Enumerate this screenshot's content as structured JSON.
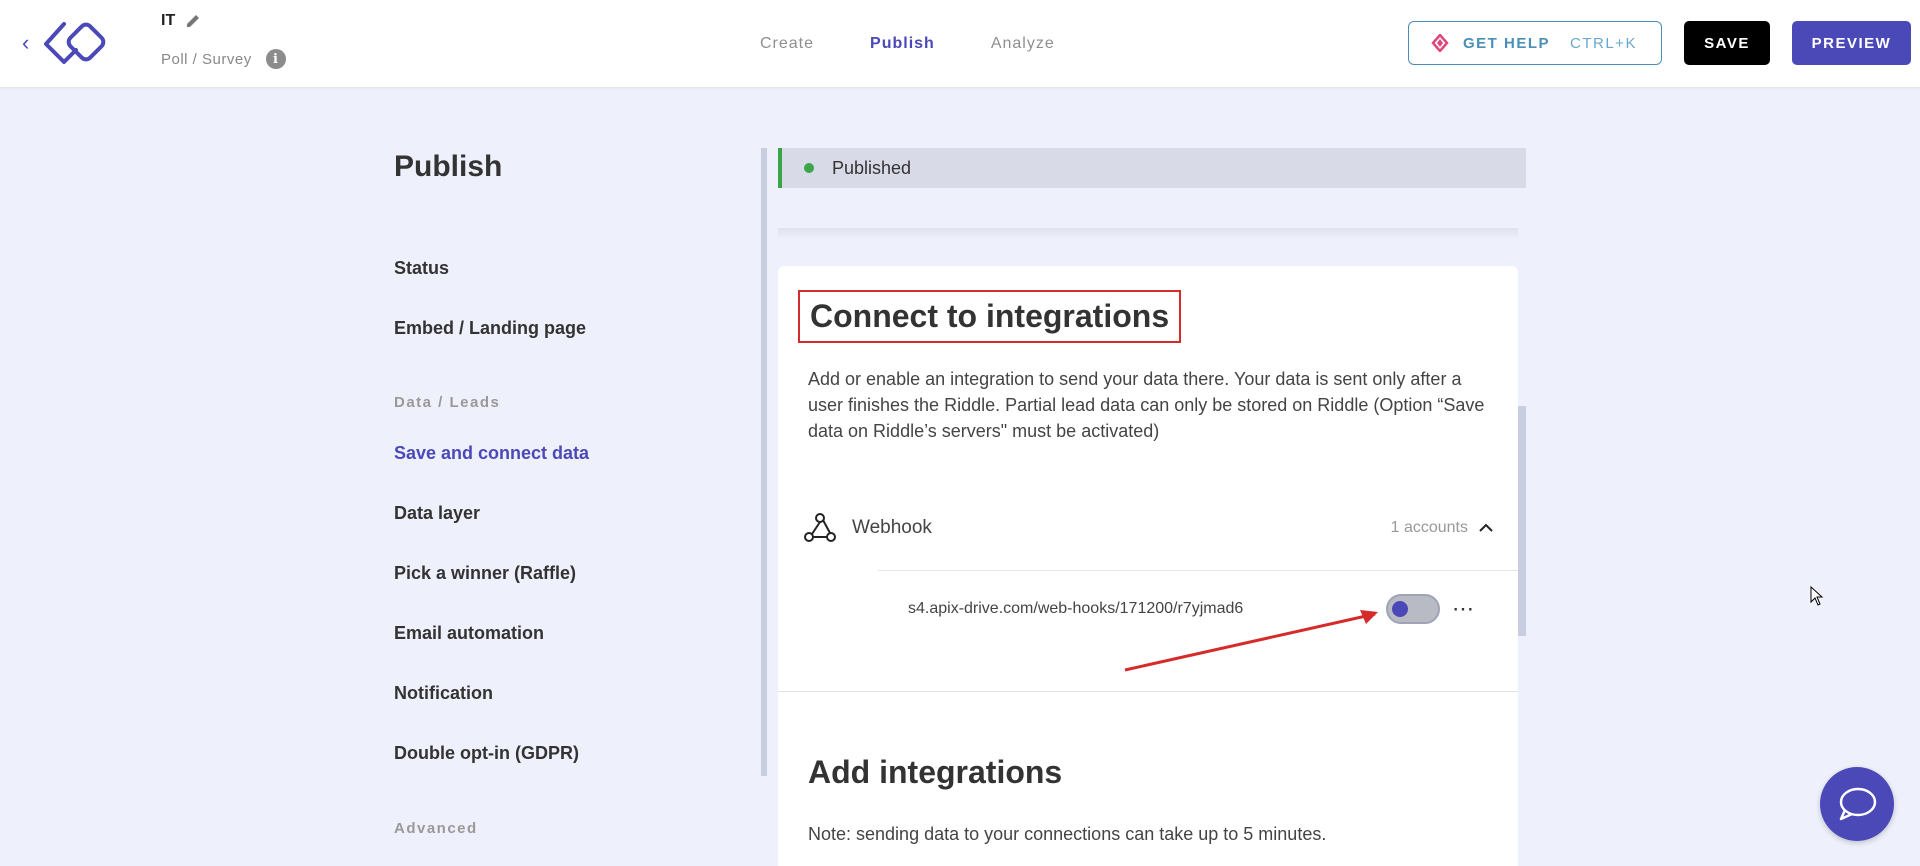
{
  "header": {
    "project_title": "IT",
    "project_type": "Poll / Survey",
    "tabs": [
      {
        "label": "Create",
        "active": false
      },
      {
        "label": "Publish",
        "active": true
      },
      {
        "label": "Analyze",
        "active": false
      }
    ],
    "help_label": "GET HELP",
    "help_shortcut": "CTRL+K",
    "save_label": "SAVE",
    "preview_label": "PREVIEW"
  },
  "sidebar": {
    "heading": "Publish",
    "items": [
      {
        "label": "Status"
      },
      {
        "label": "Embed / Landing page"
      },
      {
        "section": "Data / Leads"
      },
      {
        "label": "Save and connect data",
        "active": true
      },
      {
        "label": "Data layer"
      },
      {
        "label": "Pick a winner (Raffle)"
      },
      {
        "label": "Email automation"
      },
      {
        "label": "Notification"
      },
      {
        "label": "Double opt-in (GDPR)"
      },
      {
        "section": "Advanced"
      }
    ]
  },
  "status": {
    "text": "Published",
    "color": "#3aa649"
  },
  "integrations": {
    "title": "Connect to integrations",
    "description": "Add or enable an integration to send your data there. Your data is sent only after a user finishes the Riddle. Partial lead data can only be stored on Riddle (Option “Save data on Riddle’s servers\" must be activated)",
    "webhook": {
      "name": "Webhook",
      "accounts_label": "1 accounts",
      "account_url": "s4.apix-drive.com/web-hooks/171200/r7yjmad6",
      "enabled": false
    },
    "add_title": "Add integrations",
    "add_note": "Note: sending data to your connections can take up to 5 minutes."
  },
  "colors": {
    "accent": "#4b48b8",
    "annotation": "#d62b2b",
    "background": "#eef1fb"
  }
}
